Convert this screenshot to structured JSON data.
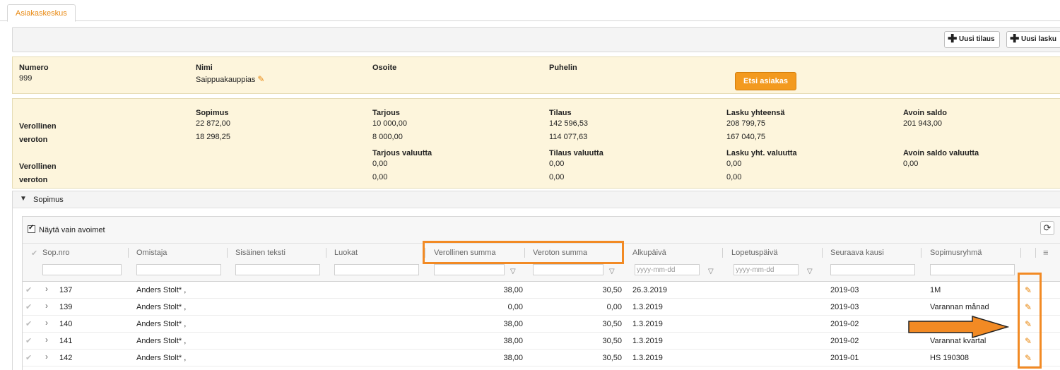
{
  "tabs": {
    "active": "Asiakaskeskus"
  },
  "toolbar": {
    "new_order": "Uusi tilaus",
    "new_invoice": "Uusi lasku"
  },
  "customer": {
    "number_label": "Numero",
    "number_value": "999",
    "name_label": "Nimi",
    "name_value": "Saippuakauppias",
    "address_label": "Osoite",
    "phone_label": "Puhelin",
    "search_button": "Etsi asiakas"
  },
  "summary": {
    "row_labels": [
      "Verollinen",
      "veroton",
      "Verollinen",
      "veroton"
    ],
    "columns": [
      {
        "label": "Sopimus",
        "taxed": "22 872,00",
        "untaxed": "18 298,25",
        "cur_label": "",
        "cur_taxed": "",
        "cur_untaxed": ""
      },
      {
        "label": "Tarjous",
        "taxed": "10 000,00",
        "untaxed": "8 000,00",
        "cur_label": "Tarjous valuutta",
        "cur_taxed": "0,00",
        "cur_untaxed": "0,00"
      },
      {
        "label": "Tilaus",
        "taxed": "142 596,53",
        "untaxed": "114 077,63",
        "cur_label": "Tilaus valuutta",
        "cur_taxed": "0,00",
        "cur_untaxed": "0,00"
      },
      {
        "label": "Lasku yhteensä",
        "taxed": "208 799,75",
        "untaxed": "167 040,75",
        "cur_label": "Lasku yht. valuutta",
        "cur_taxed": "0,00",
        "cur_untaxed": "0,00"
      },
      {
        "label": "Avoin saldo",
        "taxed": "201 943,00",
        "untaxed": "",
        "cur_label": "Avoin saldo valuutta",
        "cur_taxed": "0,00",
        "cur_untaxed": ""
      }
    ]
  },
  "contracts": {
    "section_title": "Sopimus",
    "only_open_label": "Näytä vain avoimet",
    "columns": [
      "Sop.nro",
      "Omistaja",
      "Sisäinen teksti",
      "Luokat",
      "Verollinen summa",
      "Veroton summa",
      "Alkupäivä",
      "Lopetuspäivä",
      "Seuraava kausi",
      "Sopimusryhmä"
    ],
    "date_placeholder": "yyyy-mm-dd",
    "rows": [
      {
        "nro": "137",
        "owner": "Anders Stolt* ,",
        "taxed": "38,00",
        "untaxed": "30,50",
        "start": "26.3.2019",
        "next": "2019-03",
        "group": "1M"
      },
      {
        "nro": "139",
        "owner": "Anders Stolt* ,",
        "taxed": "0,00",
        "untaxed": "0,00",
        "start": "1.3.2019",
        "next": "2019-03",
        "group": "Varannan månad"
      },
      {
        "nro": "140",
        "owner": "Anders Stolt* ,",
        "taxed": "38,00",
        "untaxed": "30,50",
        "start": "1.3.2019",
        "next": "2019-02",
        "group": ""
      },
      {
        "nro": "141",
        "owner": "Anders Stolt* ,",
        "taxed": "38,00",
        "untaxed": "30,50",
        "start": "1.3.2019",
        "next": "2019-02",
        "group": "Varannat kvartal"
      },
      {
        "nro": "142",
        "owner": "Anders Stolt* ,",
        "taxed": "38,00",
        "untaxed": "30,50",
        "start": "1.3.2019",
        "next": "2019-01",
        "group": "HS 190308"
      }
    ]
  },
  "colors": {
    "accent": "#e8870e",
    "button": "#f39a1f",
    "panel": "#fdf5dc",
    "highlight": "#f28a24"
  }
}
